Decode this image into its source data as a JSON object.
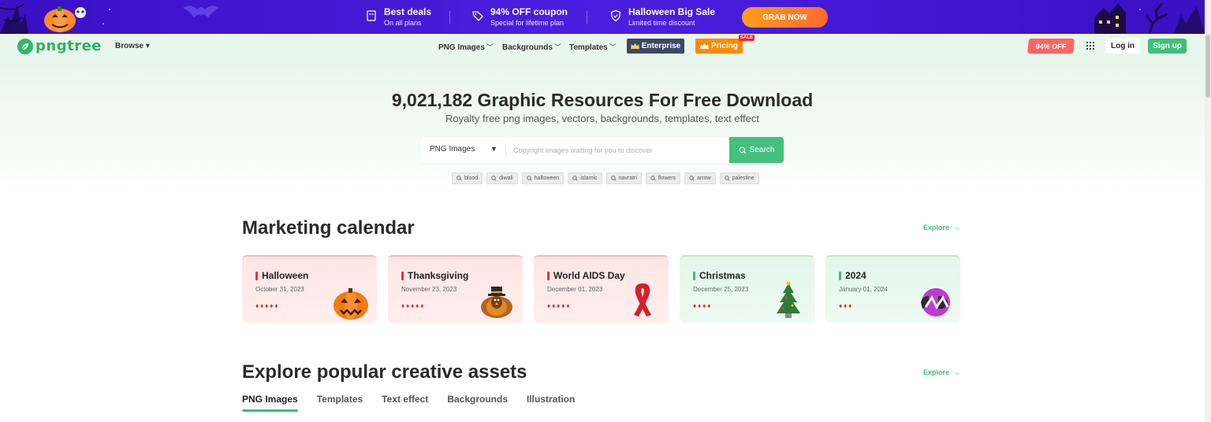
{
  "promo": {
    "items": [
      {
        "title": "Best deals",
        "sub": "On all plans",
        "icon": "ticket-icon"
      },
      {
        "title": "94% OFF coupon",
        "sub": "Special for lifetime plan",
        "icon": "tag-icon"
      },
      {
        "title": "Halloween Big Sale",
        "sub": "Limited time discount",
        "icon": "shield-icon"
      }
    ],
    "cta": "GRAB NOW"
  },
  "nav": {
    "logo": "pngtree",
    "browse": "Browse",
    "links": [
      "PNG Images",
      "Backgrounds",
      "Templates"
    ],
    "enterprise": "Enterprise",
    "pricing": "Pricing",
    "sale": "SALE",
    "off_badge": "94% OFF",
    "login": "Log in",
    "signup": "Sign up"
  },
  "hero": {
    "title": "9,021,182 Graphic Resources For Free Download",
    "subtitle": "Royalty free png images, vectors, backgrounds, templates, text effect",
    "search_type": "PNG Images",
    "search_placeholder": "Copyright images waiting for you to discover",
    "search_button": "Search",
    "tags": [
      "blood",
      "diwali",
      "halloween",
      "islamic",
      "navratri",
      "flowers",
      "arrow",
      "palestine"
    ]
  },
  "calendar": {
    "title": "Marketing calendar",
    "explore": "Explore",
    "cards": [
      {
        "title": "Halloween",
        "date": "October 31, 2023",
        "drops": "♦♦♦♦♦",
        "theme": "red",
        "art": "pumpkin-icon"
      },
      {
        "title": "Thanksgiving",
        "date": "November 23, 2023",
        "drops": "♦♦♦♦♦",
        "theme": "red",
        "art": "turkey-icon"
      },
      {
        "title": "World AIDS Day",
        "date": "December 01, 2023",
        "drops": "♦♦♦♦♦",
        "theme": "red",
        "art": "ribbon-icon"
      },
      {
        "title": "Christmas",
        "date": "December 25, 2023",
        "drops": "♦♦♦♦",
        "theme": "green",
        "art": "christmas-tree-icon"
      },
      {
        "title": "2024",
        "date": "January 01, 2024",
        "drops": "♦♦♦",
        "theme": "green",
        "art": "new-year-2024-icon"
      }
    ]
  },
  "assets": {
    "title": "Explore popular creative assets",
    "explore": "Explore",
    "tabs": [
      "PNG Images",
      "Templates",
      "Text effect",
      "Backgrounds",
      "Illustration"
    ],
    "active_tab": "PNG Images"
  },
  "colors": {
    "brand_green": "#3cbf77",
    "promo_purple": "#4b1fe0",
    "cta_orange": "#ff8a00",
    "enterprise_navy": "#3d4766"
  }
}
